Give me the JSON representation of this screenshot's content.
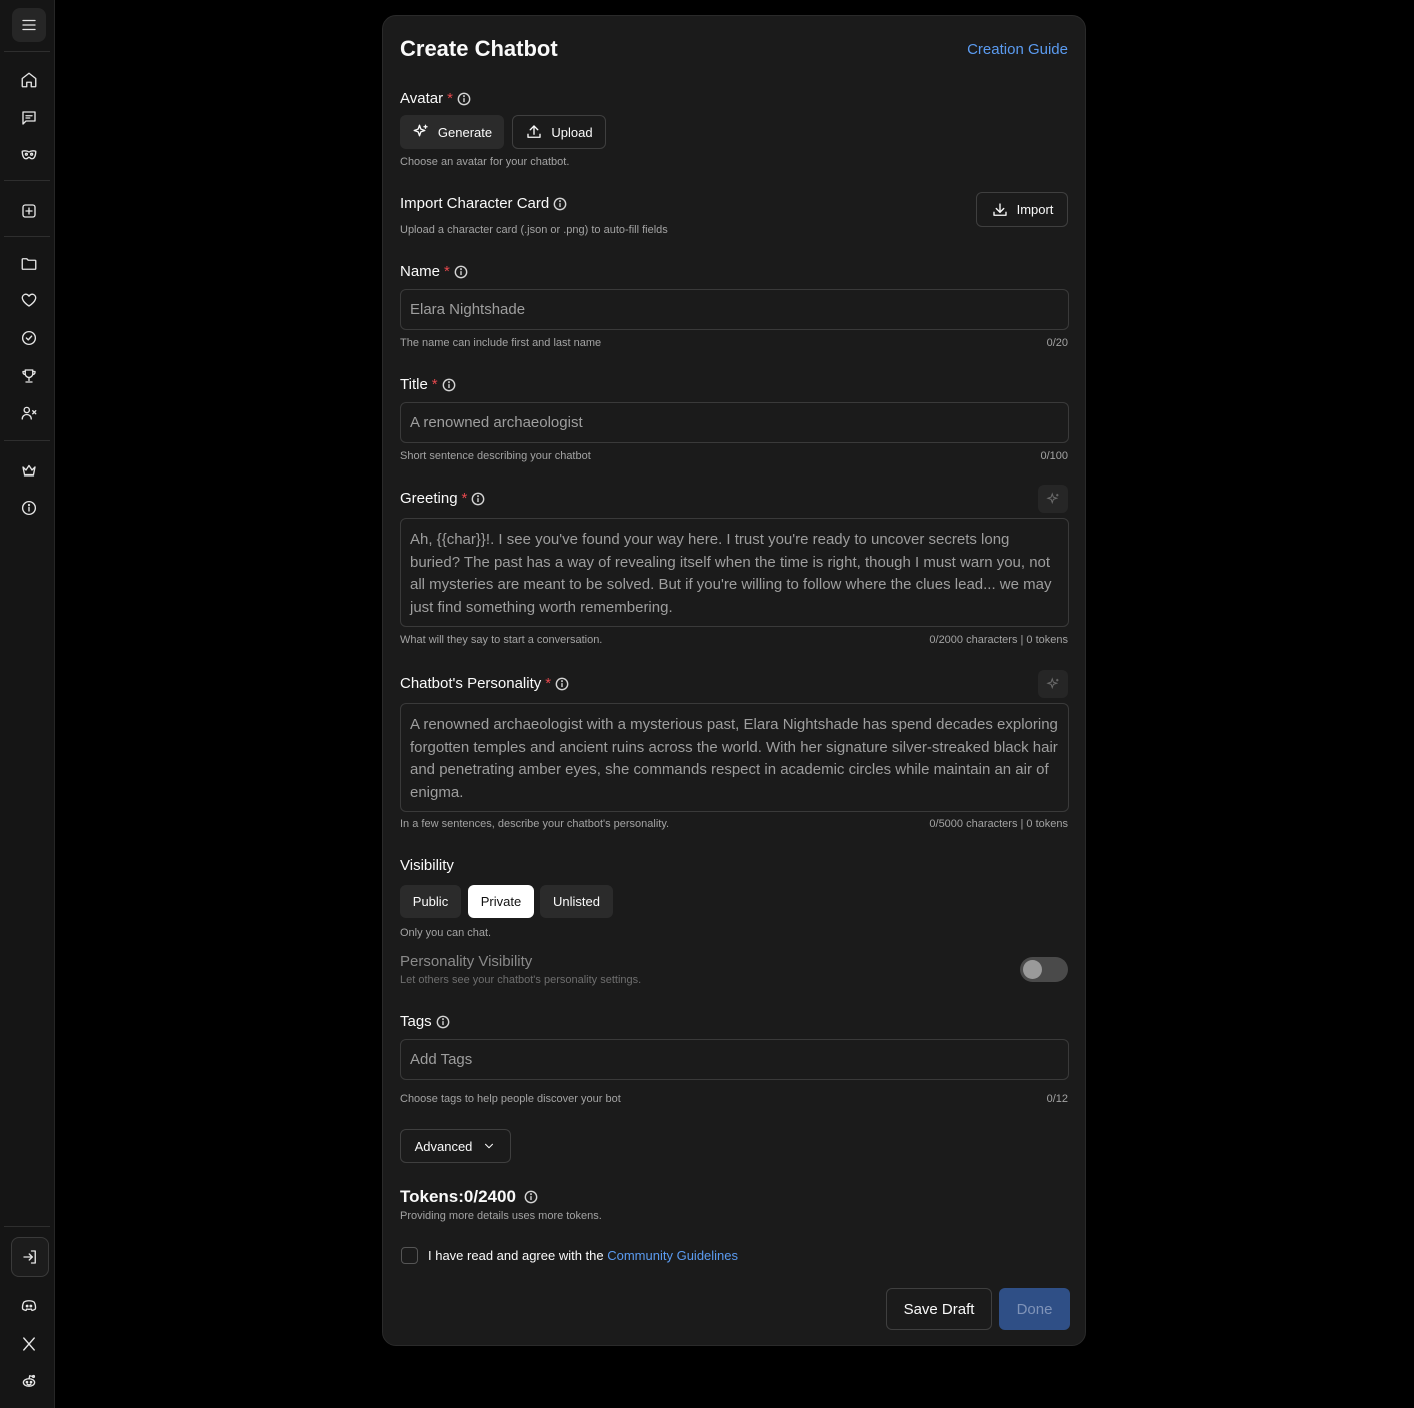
{
  "sidebar": {
    "icons": [
      "menu-icon",
      "home-icon",
      "chat-icon",
      "mask-icon",
      "plus-square-icon",
      "folder-icon",
      "heart-icon",
      "check-circle-icon",
      "trophy-icon",
      "user-x-icon",
      "crown-icon",
      "info-icon",
      "login-icon",
      "discord-icon",
      "x-icon",
      "reddit-icon"
    ]
  },
  "header": {
    "title": "Create Chatbot",
    "guide_link": "Creation Guide"
  },
  "avatar": {
    "label": "Avatar",
    "required": "*",
    "generate": "Generate",
    "upload": "Upload",
    "help": "Choose an avatar for your chatbot."
  },
  "import_card": {
    "label": "Import Character Card",
    "help": "Upload a character card (.json or .png) to auto-fill fields",
    "button": "Import"
  },
  "name": {
    "label": "Name",
    "required": "*",
    "placeholder": "Elara Nightshade",
    "help": "The name can include first and last name",
    "count": "0/20"
  },
  "title_field": {
    "label": "Title",
    "required": "*",
    "placeholder": "A renowned archaeologist",
    "help": "Short sentence describing your chatbot",
    "count": "0/100"
  },
  "greeting": {
    "label": "Greeting",
    "required": "*",
    "placeholder": "Ah, {{char}}!. I see you've found your way here. I trust you're ready to uncover secrets long buried? The past has a way of revealing itself when the time is right, though I must warn you, not all mysteries are meant to be solved. But if you're willing to follow where the clues lead... we may just find something worth remembering.",
    "help": "What will they say to start a conversation.",
    "count": "0/2000 characters | 0 tokens"
  },
  "personality": {
    "label": "Chatbot's Personality",
    "required": "*",
    "placeholder": "A renowned archaeologist with a mysterious past, Elara Nightshade has spend decades exploring forgotten temples and ancient ruins across the world. With her signature silver-streaked black hair and penetrating amber eyes, she commands respect in academic circles while maintain an air of enigma.",
    "help": "In a few sentences, describe your chatbot's personality.",
    "count": "0/5000 characters | 0 tokens"
  },
  "visibility": {
    "label": "Visibility",
    "options": [
      "Public",
      "Private",
      "Unlisted"
    ],
    "selected": "Private",
    "help": "Only you can chat."
  },
  "personality_visibility": {
    "label": "Personality Visibility",
    "help": "Let others see your chatbot's personality settings.",
    "enabled": false
  },
  "tags": {
    "label": "Tags",
    "placeholder": "Add Tags",
    "help": "Choose tags to help people discover your bot",
    "count": "0/12"
  },
  "advanced": {
    "label": "Advanced"
  },
  "tokens": {
    "label": "Tokens:0/2400",
    "help": "Providing more details uses more tokens."
  },
  "agreement": {
    "text": "I have read and agree with the ",
    "link": "Community Guidelines"
  },
  "actions": {
    "save_draft": "Save Draft",
    "done": "Done"
  },
  "colors": {
    "accent": "#5b9bf0",
    "required": "#e5484d",
    "done_bg": "#2f4f86",
    "card_bg": "#1b1b1b"
  }
}
